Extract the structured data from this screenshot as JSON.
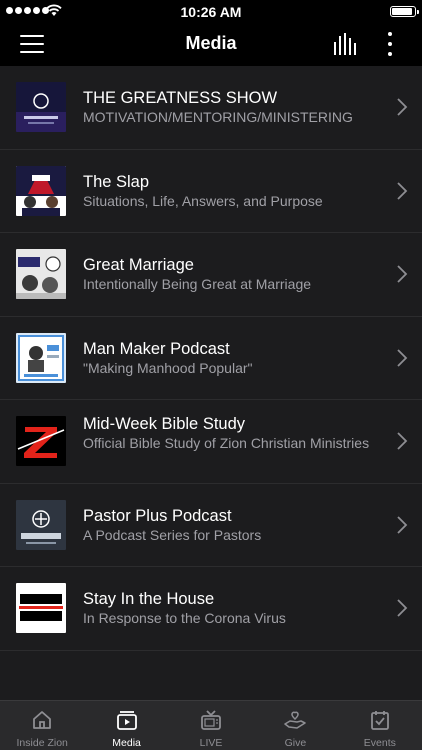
{
  "status_bar": {
    "time": "10:26 AM",
    "battery_level": 0.92
  },
  "nav": {
    "title": "Media"
  },
  "media_items": [
    {
      "title": "THE GREATNESS SHOW",
      "subtitle": "MOTIVATION/MENTORING/MINISTERING",
      "thumb_text": "GREATNESS SHOW"
    },
    {
      "title": "The Slap",
      "subtitle": "Situations, Life, Answers, and Purpose",
      "thumb_text": "SLAP"
    },
    {
      "title": "Great Marriage",
      "subtitle": "Intentionally Being Great at Marriage",
      "thumb_text": "MARRIAGE"
    },
    {
      "title": "Man Maker Podcast",
      "subtitle": "\"Making Manhood Popular\"",
      "thumb_text": ""
    },
    {
      "title": "Mid-Week Bible Study",
      "subtitle": "Official Bible Study of Zion Christian Ministries",
      "thumb_text": "Z"
    },
    {
      "title": "Pastor Plus Podcast",
      "subtitle": "A Podcast Series for Pastors",
      "thumb_text": "PODCAST"
    },
    {
      "title": "Stay In the House",
      "subtitle": "In Response to the Corona Virus",
      "thumb_text": "STAY IN THE HOUSE!"
    }
  ],
  "tabs": [
    {
      "label": "Inside Zion",
      "icon": "home-icon",
      "active": false
    },
    {
      "label": "Media",
      "icon": "media-icon",
      "active": true
    },
    {
      "label": "LIVE",
      "icon": "tv-icon",
      "active": false
    },
    {
      "label": "Give",
      "icon": "give-icon",
      "active": false
    },
    {
      "label": "Events",
      "icon": "calendar-check-icon",
      "active": false
    }
  ],
  "colors": {
    "background": "#000000",
    "list_background": "#1c1c1e",
    "subtitle": "#a0a0a6",
    "tabbar": "#2a2a2c",
    "tab_inactive": "#8e8e93",
    "zion_red": "#e2231a"
  }
}
